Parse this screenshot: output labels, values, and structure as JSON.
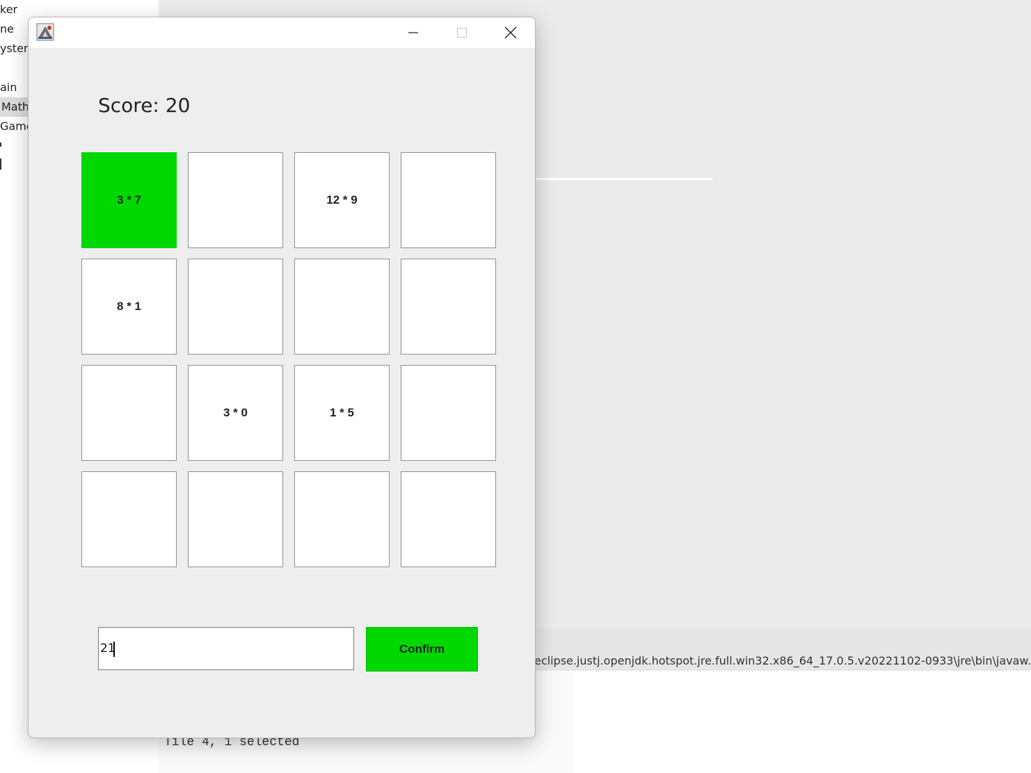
{
  "background": {
    "tree_items": [
      "ker",
      "ne",
      "ystem",
      "ain",
      "Math",
      "Game"
    ],
    "console_path": "eclipse.justj.openjdk.hotspot.jre.full.win32.x86_64_17.0.5.v20221102-0933\\jre\\bin\\javaw.exe",
    "console_output": "Tile 4, 1 selected"
  },
  "window": {
    "icon": "java-app-icon",
    "controls": {
      "minimize": "minimize-icon",
      "maximize": "maximize-icon",
      "close": "close-icon"
    }
  },
  "score": {
    "label": "Score: 20",
    "value": 20
  },
  "grid": {
    "rows": 4,
    "cols": 4,
    "selected": {
      "row": 1,
      "col": 1
    },
    "selected_color": "#00d800",
    "tiles": [
      [
        "3 * 7",
        "",
        "12 * 9",
        ""
      ],
      [
        "8 * 1",
        "",
        "",
        ""
      ],
      [
        "",
        "3 * 0",
        "1 * 5",
        ""
      ],
      [
        "",
        "",
        "",
        ""
      ]
    ]
  },
  "answer": {
    "value": "21"
  },
  "confirm": {
    "label": "Confirm",
    "color": "#00d800"
  }
}
